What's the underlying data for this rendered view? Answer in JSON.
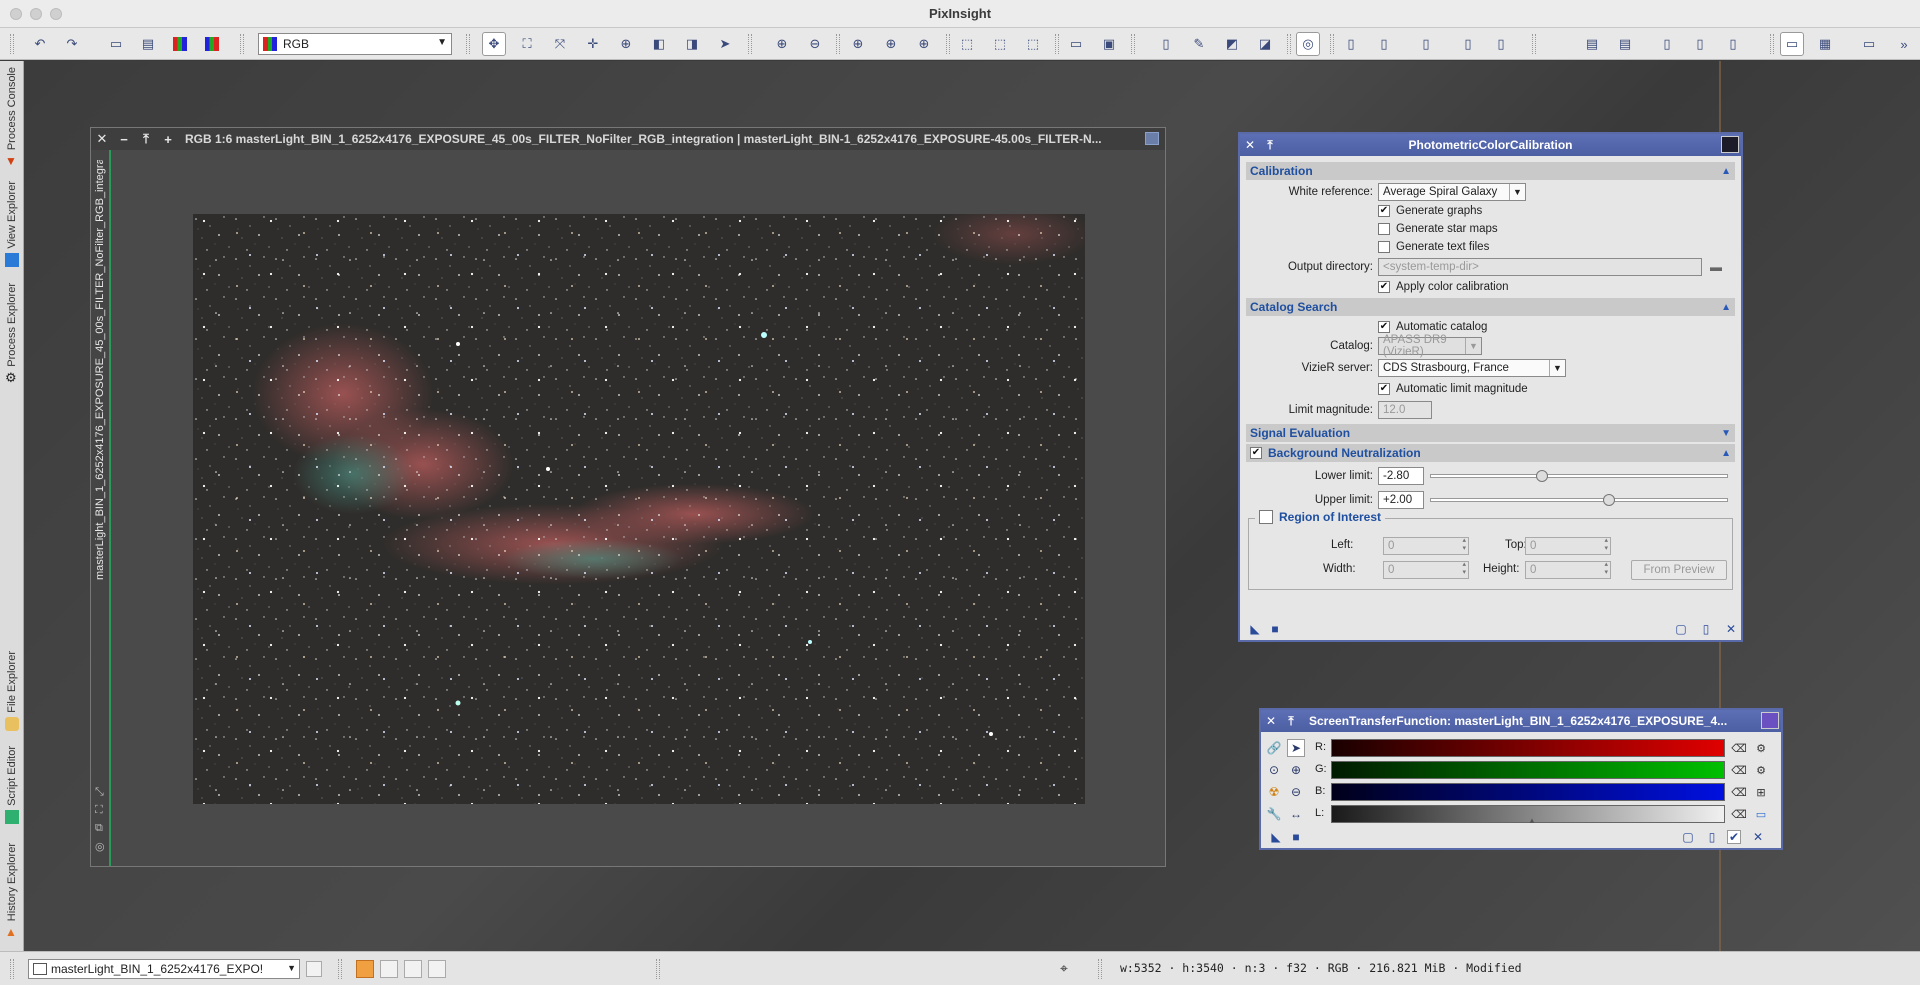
{
  "app": {
    "title": "PixInsight"
  },
  "toolbar": {
    "color_mode": "RGB"
  },
  "left_tabs": [
    "Process Console",
    "View Explorer",
    "Process Explorer",
    "File Explorer",
    "Script Editor",
    "History Explorer"
  ],
  "image_window": {
    "title": "RGB 1:6 masterLight_BIN_1_6252x4176_EXPOSURE_45_00s_FILTER_NoFilter_RGB_integration | masterLight_BIN-1_6252x4176_EXPOSURE-45.00s_FILTER-N...",
    "view_id": "masterLight_BIN_1_6252x4176_EXPOSURE_45_00s_FILTER_NoFilter_RGB_integration"
  },
  "pcc": {
    "title": "PhotometricColorCalibration",
    "calibration": {
      "header": "Calibration",
      "white_reference_label": "White reference:",
      "white_reference_value": "Average Spiral Galaxy",
      "generate_graphs": "Generate graphs",
      "generate_star_maps": "Generate star maps",
      "generate_text_files": "Generate text files",
      "output_directory_label": "Output directory:",
      "output_directory_placeholder": "<system-temp-dir>",
      "apply_color_calibration": "Apply color calibration"
    },
    "catalog_search": {
      "header": "Catalog Search",
      "automatic_catalog": "Automatic catalog",
      "catalog_label": "Catalog:",
      "catalog_value": "APASS DR9 (VizieR)",
      "vizier_label": "VizieR server:",
      "vizier_value": "CDS Strasbourg, France",
      "automatic_limit_magnitude": "Automatic limit magnitude",
      "limit_magnitude_label": "Limit magnitude:",
      "limit_magnitude_value": "12.0"
    },
    "signal_evaluation": {
      "header": "Signal Evaluation"
    },
    "background_neutralization": {
      "header": "Background Neutralization",
      "lower_limit_label": "Lower limit:",
      "lower_limit_value": "-2.80",
      "upper_limit_label": "Upper limit:",
      "upper_limit_value": "+2.00",
      "roi_header": "Region of Interest",
      "left_label": "Left:",
      "left_value": "0",
      "top_label": "Top:",
      "top_value": "0",
      "width_label": "Width:",
      "width_value": "0",
      "height_label": "Height:",
      "height_value": "0",
      "from_preview": "From Preview"
    }
  },
  "stf": {
    "title": "ScreenTransferFunction: masterLight_BIN_1_6252x4176_EXPOSURE_4...",
    "channels": [
      "R:",
      "G:",
      "B:",
      "L:"
    ]
  },
  "statusbar": {
    "view_name": "masterLight_BIN_1_6252x4176_EXPO!",
    "info": "w:5352 · h:3540 · n:3 · f32 · RGB · 216.821 MiB · Modified"
  },
  "colors": {
    "panel_header": "#5566ad",
    "section_text": "#1f4fa0",
    "red": "#e00000",
    "green": "#00c000",
    "blue": "#0010e0"
  }
}
